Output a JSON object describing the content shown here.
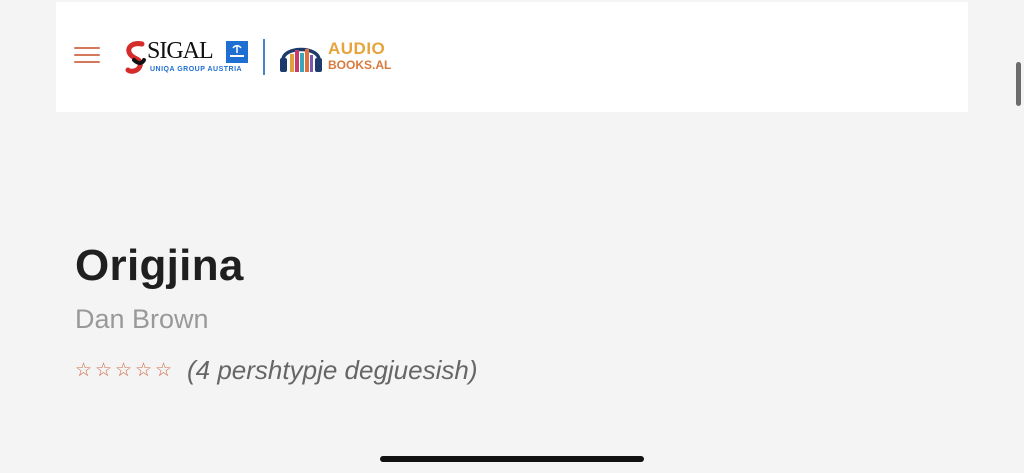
{
  "header": {
    "menu_icon": "hamburger-menu-icon",
    "sigal_logo": {
      "name": "SIGAL",
      "subtitle": "UNIQA GROUP AUSTRIA",
      "color": "#1f6ed2"
    },
    "audio_logo": {
      "top": "AUDIO",
      "bottom": "BOOKS.AL"
    }
  },
  "book": {
    "title": "Origjina",
    "author": "Dan Brown",
    "rating_stars": 0,
    "rating_max": 5,
    "star_char": "☆",
    "reviews_text": "(4 pershtypje degjuesish)"
  },
  "colors": {
    "accent": "#d4775a",
    "title": "#1f1f1f",
    "author": "#999999",
    "background": "#f4f4f4"
  }
}
